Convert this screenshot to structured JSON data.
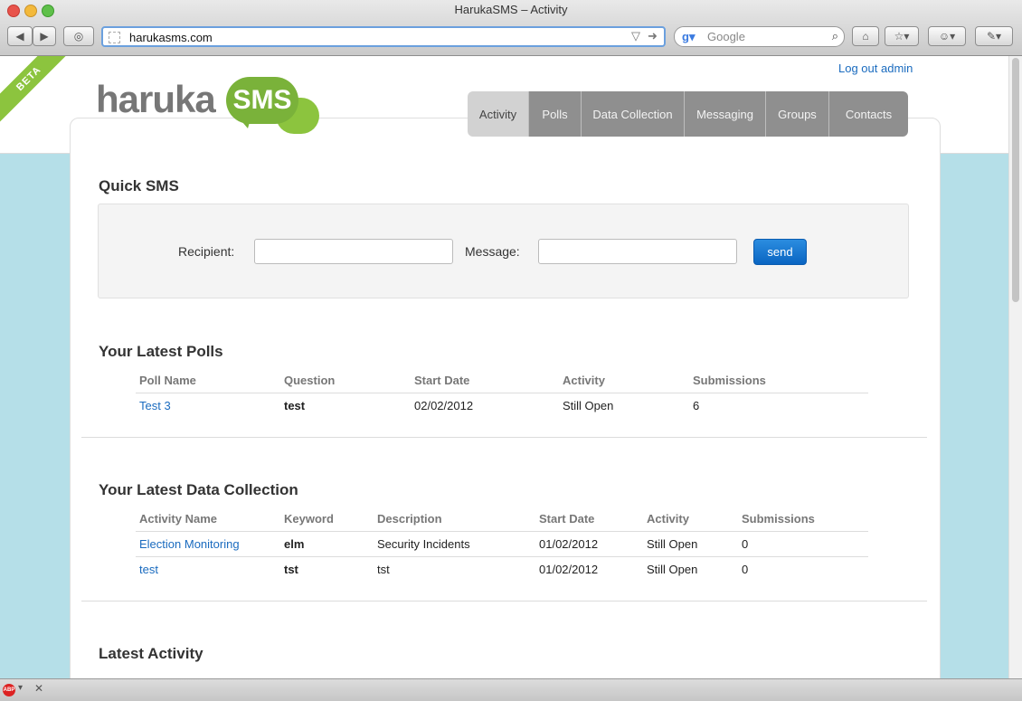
{
  "browser": {
    "window_title": "HarukaSMS – Activity",
    "url": "harukasms.com",
    "search_placeholder": "Google"
  },
  "header": {
    "beta": "BETA",
    "logout": "Log out admin",
    "logo_word": "haruka",
    "logo_bubble": "SMS"
  },
  "nav": {
    "tabs": [
      "Activity",
      "Polls",
      "Data Collection",
      "Messaging",
      "Groups",
      "Contacts"
    ],
    "active": "Activity"
  },
  "quick_sms": {
    "title": "Quick SMS",
    "recipient_label": "Recipient:",
    "message_label": "Message:",
    "recipient_value": "",
    "message_value": "",
    "send_label": "send"
  },
  "polls": {
    "title": "Your Latest Polls",
    "headers": [
      "Poll Name",
      "Question",
      "Start Date",
      "Activity",
      "Submissions"
    ],
    "rows": [
      [
        "Test 3",
        "test",
        "02/02/2012",
        "Still Open",
        "6"
      ]
    ]
  },
  "data_collection": {
    "title": "Your Latest Data Collection",
    "headers": [
      "Activity Name",
      "Keyword",
      "Description",
      "Start Date",
      "Activity",
      "Submissions"
    ],
    "rows": [
      [
        "Election Monitoring",
        "elm",
        "Security Incidents",
        "01/02/2012",
        "Still Open",
        "0"
      ],
      [
        "test",
        "tst",
        "tst",
        "01/02/2012",
        "Still Open",
        "0"
      ]
    ]
  },
  "latest_activity": {
    "title": "Latest Activity"
  },
  "statusbar": {
    "abp": "ABP"
  }
}
